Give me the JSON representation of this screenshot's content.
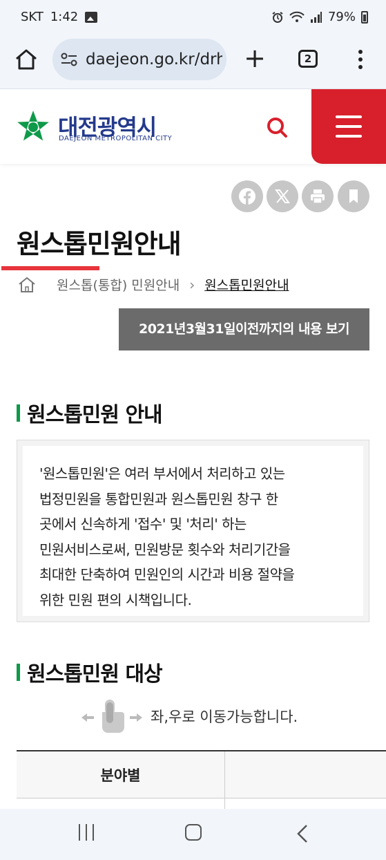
{
  "status_bar": {
    "carrier": "SKT",
    "time": "1:42",
    "battery": "79%"
  },
  "browser": {
    "url": "daejeon.go.kr/drh",
    "tab_count": "2"
  },
  "header": {
    "logo_korean": "대전광역시",
    "logo_english": "DAEJEON METROPOLITAN CITY",
    "brand_color": "#d8202c",
    "logo_color": "#243a8c"
  },
  "page": {
    "title": "원스톱민원안내",
    "breadcrumb": {
      "parent": "원스톱(통합) 민원안내",
      "separator": "›",
      "current": "원스톱민원안내"
    },
    "prev_button": "2021년3월31일이전까지의 내용 보기"
  },
  "section1": {
    "title": "원스톱민원 안내",
    "lines": [
      "'원스톱민원'은 여러 부서에서 처리하고 있는",
      "법정민원을 통합민원과 원스톱민원 창구 한",
      "곳에서 신속하게 '접수' 및 '처리' 하는",
      "민원서비스로써, 민원방문 횟수와 처리기간을",
      "최대한 단축하여 민원인의 시간과 비용 절약을",
      "위한 민원 편의 시책입니다."
    ]
  },
  "section2": {
    "title": "원스톱민원 대상",
    "swipe_hint": "좌,우로 이동가능합니다.",
    "table_headers": [
      "분야별",
      ""
    ]
  },
  "icons": {
    "share": [
      "facebook-icon",
      "x-icon",
      "print-icon",
      "bookmark-icon"
    ],
    "accent_green": "#0e9a4a",
    "accent_red": "#e8343c"
  }
}
